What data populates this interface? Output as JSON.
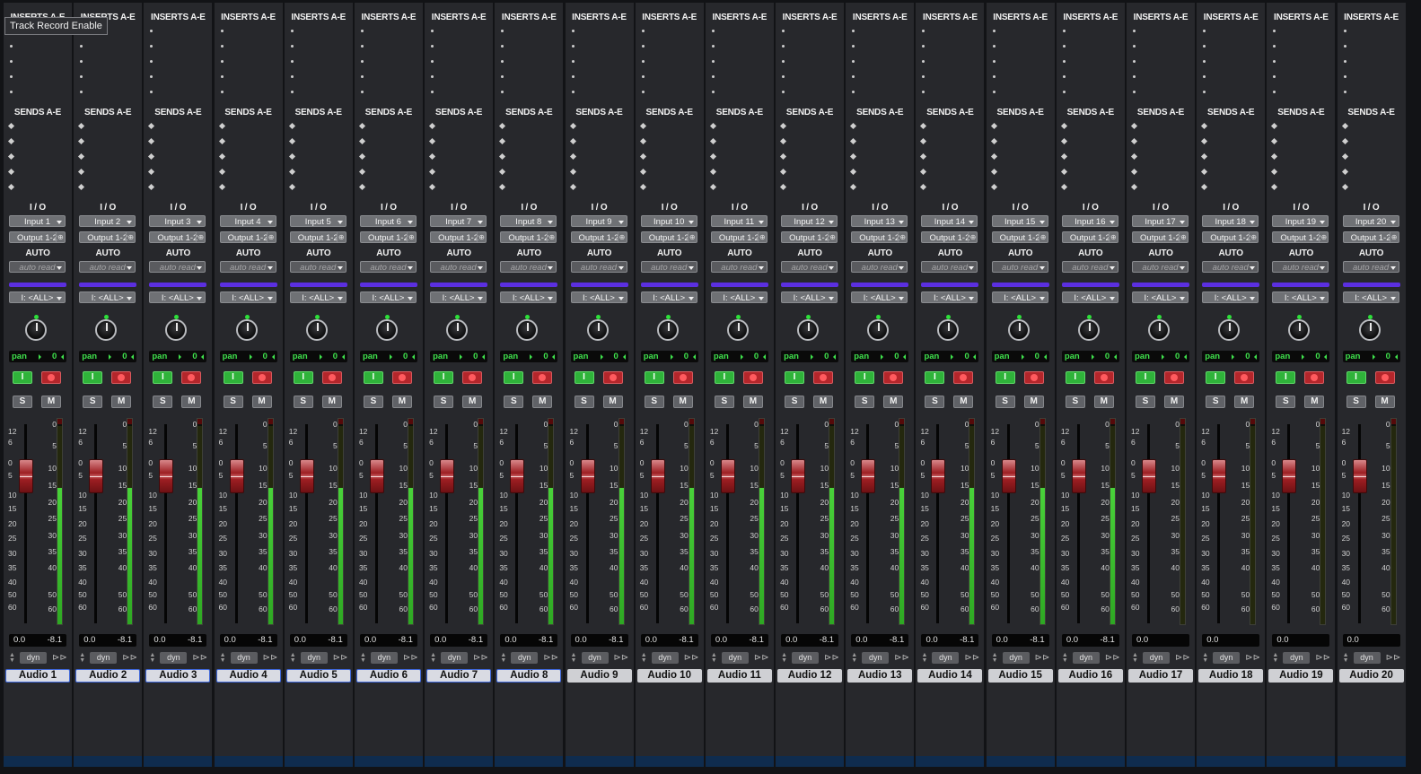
{
  "tooltip": "Track Record Enable",
  "labels": {
    "inserts": "INSERTS A-E",
    "sends": "SENDS A-E",
    "io": "I / O",
    "auto": "AUTO",
    "pan": "pan",
    "input_btn": "I",
    "solo": "S",
    "mute": "M",
    "dyn": "dyn"
  },
  "fader_scale_left": [
    "12",
    "6",
    "0",
    "5",
    "10",
    "15",
    "20",
    "25",
    "30",
    "35",
    "40",
    "50",
    "60"
  ],
  "fader_scale_right": [
    "0",
    "5",
    "10",
    "15",
    "20",
    "25",
    "30",
    "35",
    "40",
    "50",
    "60"
  ],
  "tracks": [
    {
      "name": "Audio 1",
      "input": "Input 1",
      "output": "Output 1-2",
      "automation": "auto read",
      "group": "I: <ALL>",
      "pan": "0",
      "volume": "0.0",
      "peak": "-8.1",
      "meter_level": 0.69,
      "selected": true
    },
    {
      "name": "Audio 2",
      "input": "Input 2",
      "output": "Output 1-2",
      "automation": "auto read",
      "group": "I: <ALL>",
      "pan": "0",
      "volume": "0.0",
      "peak": "-8.1",
      "meter_level": 0.69,
      "selected": true
    },
    {
      "name": "Audio 3",
      "input": "Input 3",
      "output": "Output 1-2",
      "automation": "auto read",
      "group": "I: <ALL>",
      "pan": "0",
      "volume": "0.0",
      "peak": "-8.1",
      "meter_level": 0.69,
      "selected": true
    },
    {
      "name": "Audio 4",
      "input": "Input 4",
      "output": "Output 1-2",
      "automation": "auto read",
      "group": "I: <ALL>",
      "pan": "0",
      "volume": "0.0",
      "peak": "-8.1",
      "meter_level": 0.69,
      "selected": true
    },
    {
      "name": "Audio 5",
      "input": "Input 5",
      "output": "Output 1-2",
      "automation": "auto read",
      "group": "I: <ALL>",
      "pan": "0",
      "volume": "0.0",
      "peak": "-8.1",
      "meter_level": 0.69,
      "selected": true
    },
    {
      "name": "Audio 6",
      "input": "Input 6",
      "output": "Output 1-2",
      "automation": "auto read",
      "group": "I: <ALL>",
      "pan": "0",
      "volume": "0.0",
      "peak": "-8.1",
      "meter_level": 0.69,
      "selected": true
    },
    {
      "name": "Audio 7",
      "input": "Input 7",
      "output": "Output 1-2",
      "automation": "auto read",
      "group": "I: <ALL>",
      "pan": "0",
      "volume": "0.0",
      "peak": "-8.1",
      "meter_level": 0.69,
      "selected": true
    },
    {
      "name": "Audio 8",
      "input": "Input 8",
      "output": "Output 1-2",
      "automation": "auto read",
      "group": "I: <ALL>",
      "pan": "0",
      "volume": "0.0",
      "peak": "-8.1",
      "meter_level": 0.69,
      "selected": true
    },
    {
      "name": "Audio 9",
      "input": "Input 9",
      "output": "Output 1-2",
      "automation": "auto read",
      "group": "I: <ALL>",
      "pan": "0",
      "volume": "0.0",
      "peak": "-8.1",
      "meter_level": 0.69,
      "selected": false
    },
    {
      "name": "Audio 10",
      "input": "Input 10",
      "output": "Output 1-2",
      "automation": "auto read",
      "group": "I: <ALL>",
      "pan": "0",
      "volume": "0.0",
      "peak": "-8.1",
      "meter_level": 0.69,
      "selected": false
    },
    {
      "name": "Audio 11",
      "input": "Input 11",
      "output": "Output 1-2",
      "automation": "auto read",
      "group": "I: <ALL>",
      "pan": "0",
      "volume": "0.0",
      "peak": "-8.1",
      "meter_level": 0.69,
      "selected": false
    },
    {
      "name": "Audio 12",
      "input": "Input 12",
      "output": "Output 1-2",
      "automation": "auto read",
      "group": "I: <ALL>",
      "pan": "0",
      "volume": "0.0",
      "peak": "-8.1",
      "meter_level": 0.69,
      "selected": false
    },
    {
      "name": "Audio 13",
      "input": "Input 13",
      "output": "Output 1-2",
      "automation": "auto read",
      "group": "I: <ALL>",
      "pan": "0",
      "volume": "0.0",
      "peak": "-8.1",
      "meter_level": 0.69,
      "selected": false
    },
    {
      "name": "Audio 14",
      "input": "Input 14",
      "output": "Output 1-2",
      "automation": "auto read",
      "group": "I: <ALL>",
      "pan": "0",
      "volume": "0.0",
      "peak": "-8.1",
      "meter_level": 0.69,
      "selected": false
    },
    {
      "name": "Audio 15",
      "input": "Input 15",
      "output": "Output 1-2",
      "automation": "auto read",
      "group": "I: <ALL>",
      "pan": "0",
      "volume": "0.0",
      "peak": "-8.1",
      "meter_level": 0.69,
      "selected": false
    },
    {
      "name": "Audio 16",
      "input": "Input 16",
      "output": "Output 1-2",
      "automation": "auto read",
      "group": "I: <ALL>",
      "pan": "0",
      "volume": "0.0",
      "peak": "-8.1",
      "meter_level": 0.69,
      "selected": false
    },
    {
      "name": "Audio 17",
      "input": "Input 17",
      "output": "Output 1-2",
      "automation": "auto read",
      "group": "I: <ALL>",
      "pan": "0",
      "volume": "0.0",
      "peak": "",
      "meter_level": 0,
      "selected": false
    },
    {
      "name": "Audio 18",
      "input": "Input 18",
      "output": "Output 1-2",
      "automation": "auto read",
      "group": "I: <ALL>",
      "pan": "0",
      "volume": "0.0",
      "peak": "",
      "meter_level": 0,
      "selected": false
    },
    {
      "name": "Audio 19",
      "input": "Input 19",
      "output": "Output 1-2",
      "automation": "auto read",
      "group": "I: <ALL>",
      "pan": "0",
      "volume": "0.0",
      "peak": "",
      "meter_level": 0,
      "selected": false
    },
    {
      "name": "Audio 20",
      "input": "Input 20",
      "output": "Output 1-2",
      "automation": "auto read",
      "group": "I: <ALL>",
      "pan": "0",
      "volume": "0.0",
      "peak": "",
      "meter_level": 0,
      "selected": false
    }
  ],
  "colors": {
    "record_arm": "#b4262b",
    "input_monitor": "#2fb33a",
    "vca_bar": "#5b2fe0",
    "meter_green": "#49d23a",
    "selection_outline": "#3f67d8"
  }
}
